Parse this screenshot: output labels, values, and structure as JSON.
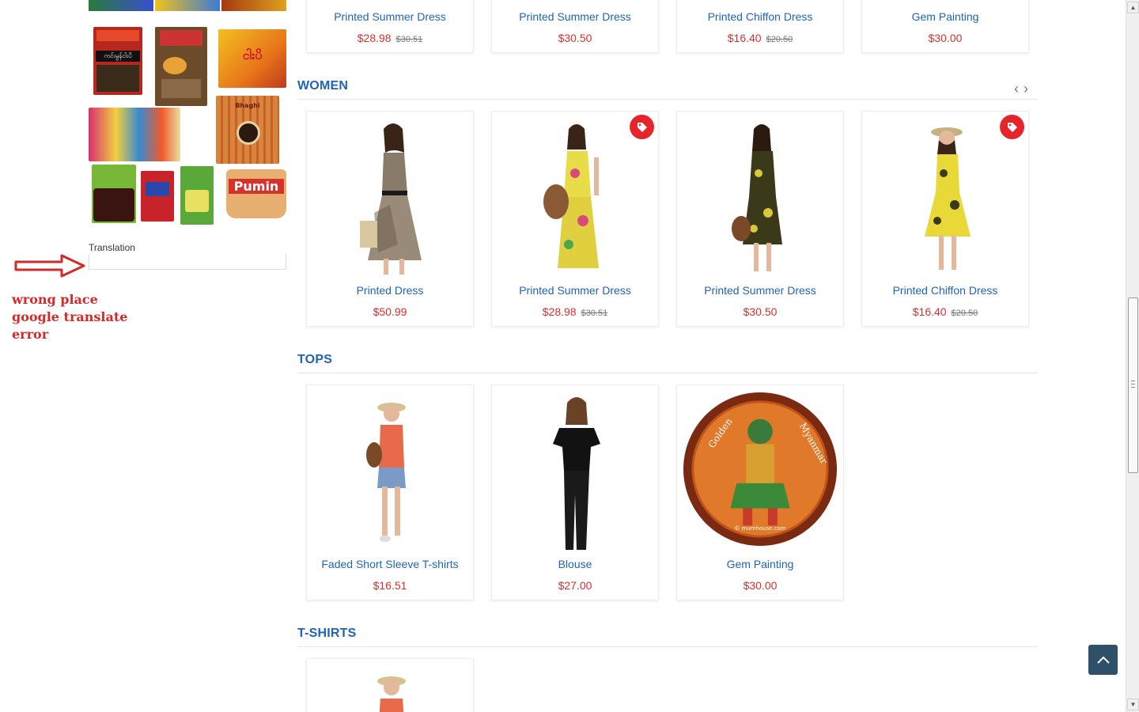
{
  "sidebar": {
    "thumbnails": [
      {
        "name": "spice-pack-red",
        "label": "ကင်းမွန်ငါးပိ"
      },
      {
        "name": "snack-bag",
        "label": ""
      },
      {
        "name": "orange-pack",
        "label": "ငါးပိ"
      },
      {
        "name": "multicolor-packs",
        "label": ""
      },
      {
        "name": "bhaghi-pack",
        "label": "Bhaghi"
      },
      {
        "name": "green-pack-1",
        "label": ""
      },
      {
        "name": "red-pack",
        "label": ""
      },
      {
        "name": "green-pack-2",
        "label": ""
      },
      {
        "name": "pumin-tub",
        "label": "Pumin"
      }
    ],
    "translation_label": "Translation"
  },
  "annotation": {
    "line1": "wrong place",
    "line2": "google translate",
    "line3": "error"
  },
  "top_row": [
    {
      "name": "Printed Summer Dress",
      "price": "$28.98",
      "old_price": "$30.51"
    },
    {
      "name": "Printed Summer Dress",
      "price": "$30.50",
      "old_price": ""
    },
    {
      "name": "Printed Chiffon Dress",
      "price": "$16.40",
      "old_price": "$20.50"
    },
    {
      "name": "Gem Painting",
      "price": "$30.00",
      "old_price": ""
    }
  ],
  "women": {
    "title": "WOMEN",
    "prev": "‹",
    "next": "›",
    "products": [
      {
        "name": "Printed Dress",
        "price": "$50.99",
        "old_price": "",
        "sale": false
      },
      {
        "name": "Printed Summer Dress",
        "price": "$28.98",
        "old_price": "$30.51",
        "sale": true
      },
      {
        "name": "Printed Summer Dress",
        "price": "$30.50",
        "old_price": "",
        "sale": false
      },
      {
        "name": "Printed Chiffon Dress",
        "price": "$16.40",
        "old_price": "$20.50",
        "sale": true
      }
    ]
  },
  "tops": {
    "title": "TOPS",
    "products": [
      {
        "name": "Faded Short Sleeve T-shirts",
        "price": "$16.51",
        "old_price": ""
      },
      {
        "name": "Blouse",
        "price": "$27.00",
        "old_price": ""
      },
      {
        "name": "Gem Painting",
        "price": "$30.00",
        "old_price": ""
      }
    ],
    "gem_text_left": "Golden",
    "gem_text_right": "Myanmar",
    "gem_watermark": "© mumhouse.com"
  },
  "tshirts": {
    "title": "T-SHIRTS"
  },
  "colors": {
    "link_blue": "#1f64b5",
    "price_red": "#d9302f",
    "sale_red": "#e5252a",
    "back_top": "#2f5069",
    "annotation_red": "#d32a2a"
  },
  "icons": {
    "sale": "tag-icon",
    "back_to_top": "chevron-up-icon",
    "arrow": "right-arrow-icon"
  }
}
